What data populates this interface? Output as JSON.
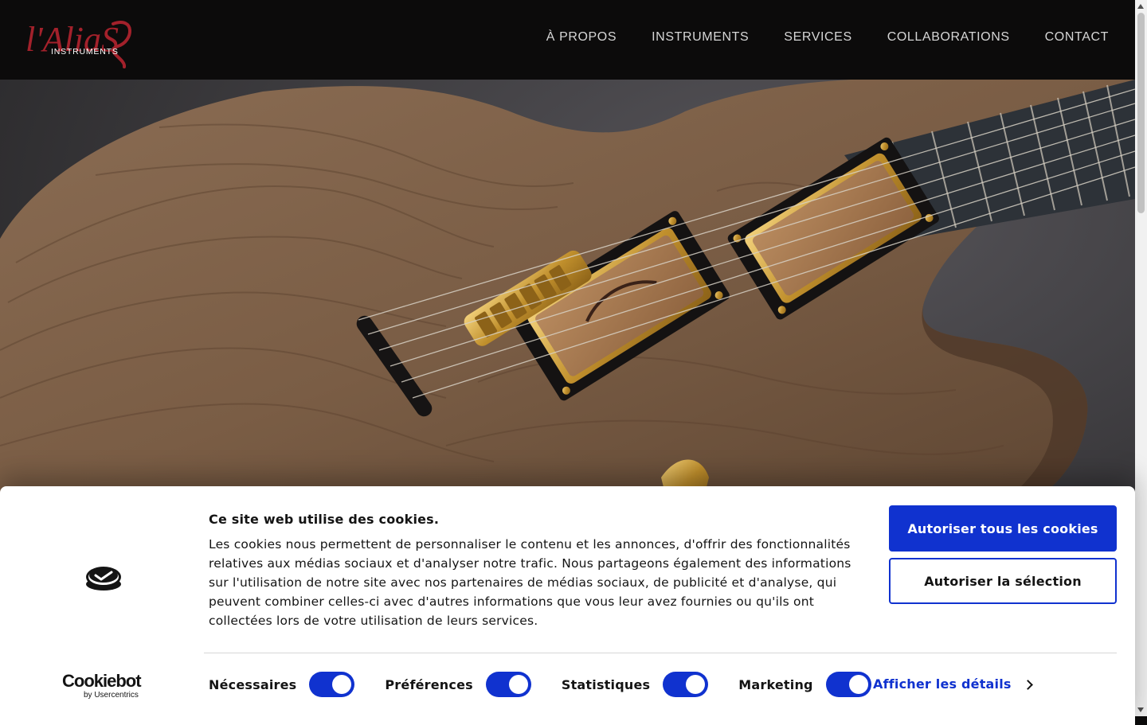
{
  "header": {
    "logo": {
      "text_main": "l'AliaS",
      "text_sub": "INSTRUMENTS",
      "color_main": "#a3212b",
      "color_sub": "#ffffff"
    },
    "nav": [
      {
        "label": "À PROPOS"
      },
      {
        "label": "INSTRUMENTS"
      },
      {
        "label": "SERVICES"
      },
      {
        "label": "COLLABORATIONS"
      },
      {
        "label": "CONTACT"
      }
    ]
  },
  "hero": {
    "image": "walnut-electric-guitar-photo",
    "background": "#3a3839",
    "wood": "#7a5d45"
  },
  "cookie_banner": {
    "title": "Ce site web utilise des cookies.",
    "description": "Les cookies nous permettent de personnaliser le contenu et les annonces, d'offrir des fonctionnalités relatives aux médias sociaux et d'analyser notre trafic. Nous partageons également des informations sur l'utilisation de notre site avec nos partenaires de médias sociaux, de publicité et d'analyse, qui peuvent combiner celles-ci avec d'autres informations que vous leur avez fournies ou qu'ils ont collectées lors de votre utilisation de leurs services.",
    "buttons": {
      "allow_all": "Autoriser tous les cookies",
      "allow_selection": "Autoriser la sélection"
    },
    "toggles": [
      {
        "label": "Nécessaires",
        "checked": true
      },
      {
        "label": "Préférences",
        "checked": true
      },
      {
        "label": "Statistiques",
        "checked": true
      },
      {
        "label": "Marketing",
        "checked": true
      }
    ],
    "details_link": "Afficher les détails",
    "brand": {
      "name": "Cookiebot",
      "sub": "by Usercentrics"
    },
    "accent_color": "#1032cf"
  }
}
